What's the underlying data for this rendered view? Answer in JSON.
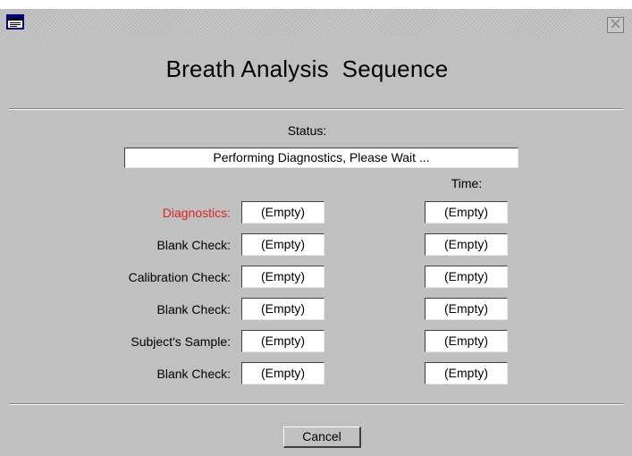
{
  "window": {
    "title": "Breath Analysis  Sequence",
    "system_icon": "window-menu-icon",
    "close_icon": "close-icon"
  },
  "status": {
    "label": "Status:",
    "value": "Performing Diagnostics, Please Wait ..."
  },
  "time_header": "Time:",
  "steps": [
    {
      "label": "Diagnostics:",
      "value": "(Empty)",
      "time": "(Empty)",
      "active": true
    },
    {
      "label": "Blank Check:",
      "value": "(Empty)",
      "time": "(Empty)",
      "active": false
    },
    {
      "label": "Calibration Check:",
      "value": "(Empty)",
      "time": "(Empty)",
      "active": false
    },
    {
      "label": "Blank Check:",
      "value": "(Empty)",
      "time": "(Empty)",
      "active": false
    },
    {
      "label": "Subject's Sample:",
      "value": "(Empty)",
      "time": "(Empty)",
      "active": false
    },
    {
      "label": "Blank Check:",
      "value": "(Empty)",
      "time": "(Empty)",
      "active": false
    }
  ],
  "cancel_label": "Cancel",
  "colors": {
    "dialog_background": "#c0c0c0",
    "active_step": "#e02020"
  }
}
